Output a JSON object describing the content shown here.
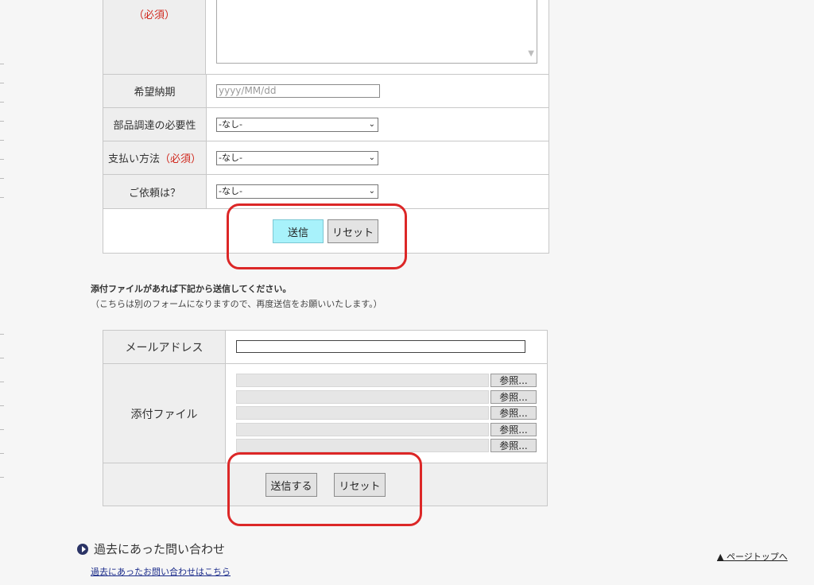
{
  "form1": {
    "inquiry_label": "（必須）",
    "delivery_date": {
      "label": "希望納期",
      "placeholder": "yyyy/MM/dd"
    },
    "parts_procurement": {
      "label": "部品調達の必要性",
      "value": "-なし-"
    },
    "payment_method": {
      "label": "支払い方法",
      "required": "（必須）",
      "value": "-なし-"
    },
    "request": {
      "label": "ご依頼は？",
      "value": "-なし-"
    },
    "submit_label": "送信",
    "reset_label": "リセット"
  },
  "notes": {
    "line1": "添付ファイルがあれば下記から送信してください。",
    "line2": "（こちらは別のフォームになりますので、再度送信をお願いいたします。）"
  },
  "form2": {
    "email_label": "メールアドレス",
    "attachment_label": "添付ファイル",
    "browse_label": "参照...",
    "file_rows": [
      "",
      "",
      "",
      "",
      ""
    ],
    "submit_label": "送信する",
    "reset_label": "リセット"
  },
  "past": {
    "title": "過去にあった問い合わせ",
    "link": "過去にあったお問い合わせはこちら"
  },
  "pagetop": "▲ ページトップへ",
  "colors": {
    "required": "#d0281d",
    "highlight": "#dc2727",
    "primary_button": "#a8f2fb"
  }
}
